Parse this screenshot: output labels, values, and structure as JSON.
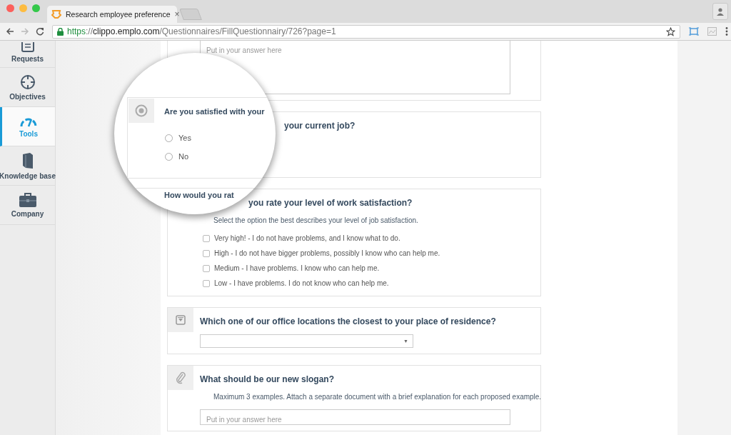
{
  "browser": {
    "tab": {
      "title": "Research employee preference",
      "close": "×"
    },
    "url_parts": [
      {
        "kind": "scheme",
        "text": "https"
      },
      {
        "kind": "sep",
        "text": "://"
      },
      {
        "kind": "host",
        "text": "clippo.emplo.com"
      },
      {
        "kind": "path",
        "text": "/Questionnaires/FillQuestionnairy/726?page=1"
      }
    ]
  },
  "sidebar": {
    "items": [
      {
        "kind": "requests",
        "label": "Requests",
        "selected": false
      },
      {
        "kind": "objectives",
        "label": "Objectives",
        "selected": false
      },
      {
        "kind": "tools",
        "label": "Tools",
        "selected": true
      },
      {
        "kind": "knowledge",
        "label": "Knowledge base",
        "selected": false
      },
      {
        "kind": "company",
        "label": "Company",
        "selected": false
      }
    ]
  },
  "questions": [
    {
      "kind": "text",
      "placeholder": "Put in your answer here"
    },
    {
      "kind": "radio",
      "title": "your current job?"
    },
    {
      "kind": "checkbox",
      "title": "you rate your level of work satisfaction?",
      "description": "Select the option the best describes your level of job satisfaction.",
      "options": [
        {
          "label": "Very high! - I do not have problems, and I know what to do.",
          "checked": false
        },
        {
          "label": "High - I do not have bigger problems, possibly I know who can help me.",
          "checked": false
        },
        {
          "label": "Medium - I have problems. I know who can help me.",
          "checked": false
        },
        {
          "label": "Low - I have problems. I do not know who can help me.",
          "checked": false
        }
      ]
    },
    {
      "kind": "select",
      "title": "Which one of our office locations the closest to your place of residence?",
      "caret": "▼"
    },
    {
      "kind": "file",
      "title": "What should be our new slogan?",
      "description": "Maximum 3 examples. Attach a separate document with a brief explanation for each proposed example.",
      "placeholder": "Put in your answer here"
    }
  ],
  "magnifier": {
    "question": "Are you satisfied with your",
    "options": [
      {
        "label": "Yes",
        "selected": false
      },
      {
        "label": "No",
        "selected": false
      }
    ],
    "next_question": "How would you rat"
  }
}
